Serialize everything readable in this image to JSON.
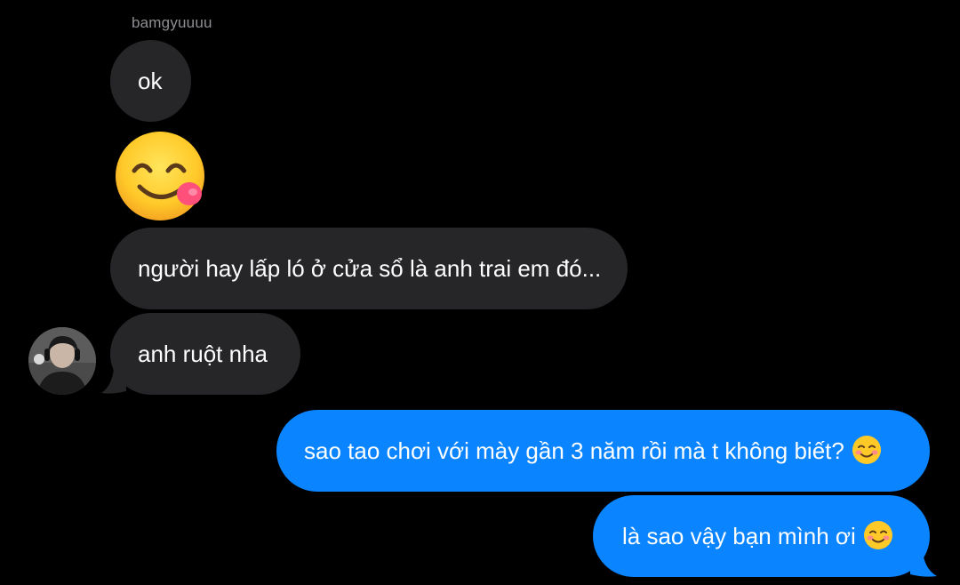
{
  "conversation": {
    "sender_name": "bamgyuuuu",
    "incoming": [
      {
        "text": "ok"
      },
      {
        "emoji": "savoring-food-emoji"
      },
      {
        "text": "người hay lấp ló ở cửa sổ là anh trai em đó..."
      },
      {
        "text": "anh ruột nha"
      }
    ],
    "outgoing": [
      {
        "text": "sao tao chơi với mày gần 3 năm rồi mà t không biết?",
        "emoji": "smiling-face-emoji"
      },
      {
        "text": "là sao vậy bạn mình ơi",
        "emoji": "smiling-face-emoji"
      }
    ]
  },
  "colors": {
    "background": "#000000",
    "incoming_bubble": "#262629",
    "outgoing_bubble": "#0a84ff",
    "sender_name": "#8e8e93",
    "text": "#ffffff"
  },
  "icons": {
    "avatar": "user-avatar",
    "big_emoji": "savoring-food-emoji",
    "inline_emoji": "smiling-face-emoji"
  }
}
